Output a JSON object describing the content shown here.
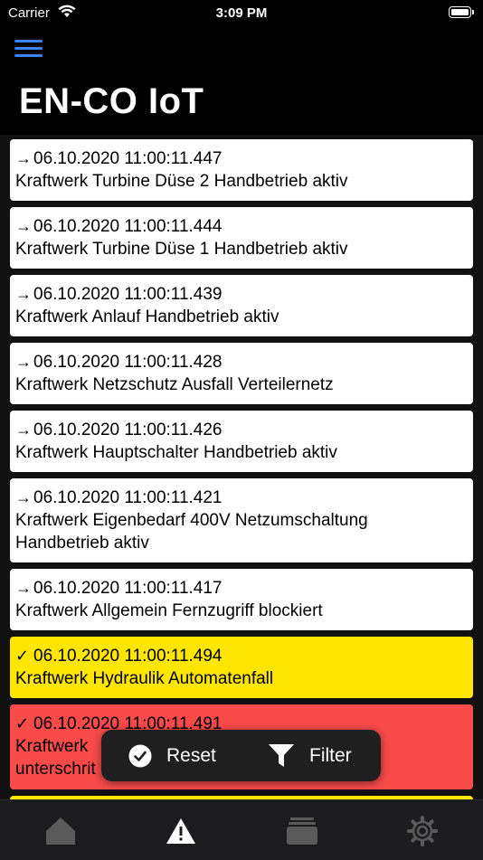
{
  "status_bar": {
    "carrier": "Carrier",
    "time": "3:09 PM"
  },
  "header": {
    "title": "EN-CO IoT"
  },
  "alarms": [
    {
      "status": "outgoing",
      "icon": "→",
      "timestamp": "06.10.2020 11:00:11.447",
      "message": "Kraftwerk Turbine Düse 2 Handbetrieb aktiv",
      "color": "#ffffff"
    },
    {
      "status": "outgoing",
      "icon": "→",
      "timestamp": "06.10.2020 11:00:11.444",
      "message": "Kraftwerk Turbine Düse 1 Handbetrieb aktiv",
      "color": "#ffffff"
    },
    {
      "status": "outgoing",
      "icon": "→",
      "timestamp": "06.10.2020 11:00:11.439",
      "message": "Kraftwerk Anlauf Handbetrieb aktiv",
      "color": "#ffffff"
    },
    {
      "status": "outgoing",
      "icon": "→",
      "timestamp": "06.10.2020 11:00:11.428",
      "message": "Kraftwerk Netzschutz Ausfall Verteilernetz",
      "color": "#ffffff"
    },
    {
      "status": "outgoing",
      "icon": "→",
      "timestamp": "06.10.2020 11:00:11.426",
      "message": "Kraftwerk Hauptschalter Handbetrieb aktiv",
      "color": "#ffffff"
    },
    {
      "status": "outgoing",
      "icon": "→",
      "timestamp": "06.10.2020 11:00:11.421",
      "message": "Kraftwerk Eigenbedarf 400V Netzumschaltung Handbetrieb aktiv",
      "color": "#ffffff"
    },
    {
      "status": "outgoing",
      "icon": "→",
      "timestamp": "06.10.2020 11:00:11.417",
      "message": "Kraftwerk Allgemein Fernzugriff blockiert",
      "color": "#ffffff"
    },
    {
      "status": "acknowledged",
      "icon": "✓",
      "timestamp": "06.10.2020 11:00:11.494",
      "message": "Kraftwerk Hydraulik Automatenfall",
      "color": "#ffe600"
    },
    {
      "status": "acknowledged",
      "icon": "✓",
      "timestamp": "06.10.2020 11:00:11.491",
      "message": "Kraftwerk ",
      "message_line2": "unterschrit",
      "color": "#fa4b4b"
    }
  ],
  "toast": {
    "reset_label": "Reset",
    "filter_label": "Filter"
  },
  "tabs": [
    {
      "name": "home",
      "icon": "home-icon",
      "active": false
    },
    {
      "name": "alarms",
      "icon": "warning-icon",
      "active": true
    },
    {
      "name": "archive",
      "icon": "archive-icon",
      "active": false
    },
    {
      "name": "settings",
      "icon": "gear-icon",
      "active": false
    }
  ],
  "colors": {
    "accent": "#3b82f6",
    "tab_active": "#ffffff",
    "tab_inactive": "#5a5a5a"
  }
}
